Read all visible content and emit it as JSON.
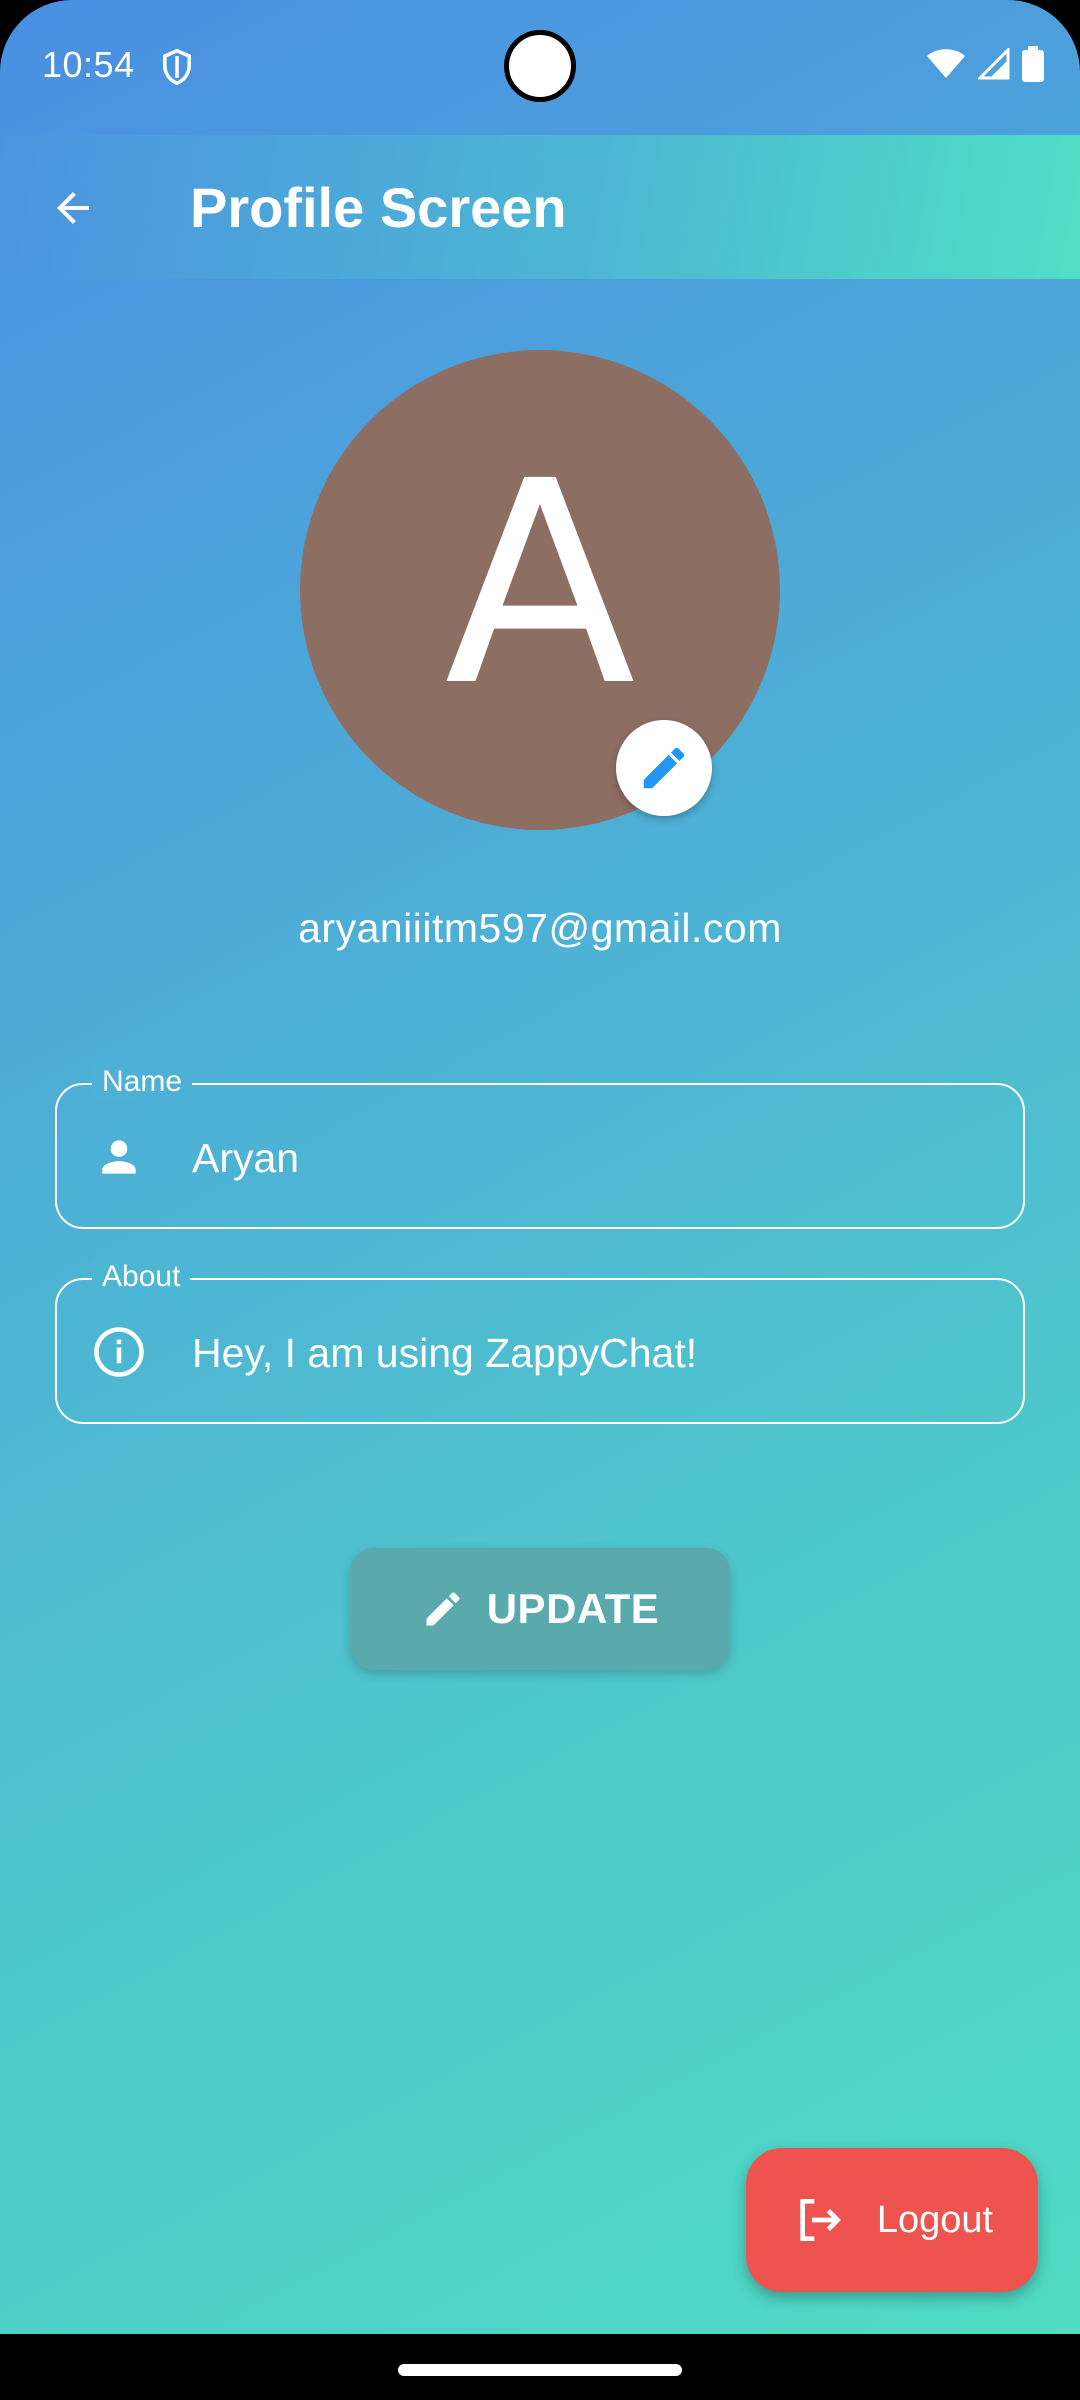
{
  "status_bar": {
    "time": "10:54",
    "icons": [
      "shield-icon",
      "wifi-icon",
      "signal-icon",
      "battery-icon"
    ]
  },
  "app_bar": {
    "title": "Profile Screen",
    "back_icon": "arrow-back-icon"
  },
  "profile": {
    "avatar_letter": "A",
    "avatar_color": "#8d6e63",
    "edit_icon": "pencil-icon",
    "email": "aryaniiitm597@gmail.com"
  },
  "fields": {
    "name": {
      "label": "Name",
      "value": "Aryan",
      "icon": "person-icon"
    },
    "about": {
      "label": "About",
      "value": "Hey, I am using ZappyChat!",
      "icon": "info-icon"
    }
  },
  "update_button": {
    "label": "UPDATE",
    "icon": "pencil-icon"
  },
  "logout_button": {
    "label": "Logout",
    "icon": "logout-icon",
    "color": "#ef5350"
  },
  "colors": {
    "gradient_start": "#4a8fe2",
    "gradient_end": "#50dbc4",
    "accent": "#2196f3"
  }
}
